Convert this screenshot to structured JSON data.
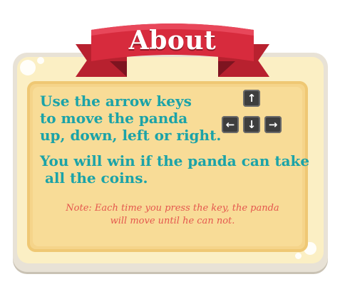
{
  "about": {
    "title": "About",
    "lines": [
      "Use the arrow keys",
      "to move the panda",
      "up, down, left or right.",
      "You will win if the panda can take",
      " all the coins."
    ],
    "note_lines": [
      "Note: Each time you press the key, the panda",
      "will move until he can not."
    ],
    "keys": {
      "up": "↑",
      "left": "←",
      "down": "↓",
      "right": "→"
    }
  },
  "colors": {
    "ribbon": "#d72b3d",
    "text": "#1ba3a8",
    "note": "#e4574e",
    "card": "#f8dc97",
    "board": "#fbefc4"
  }
}
